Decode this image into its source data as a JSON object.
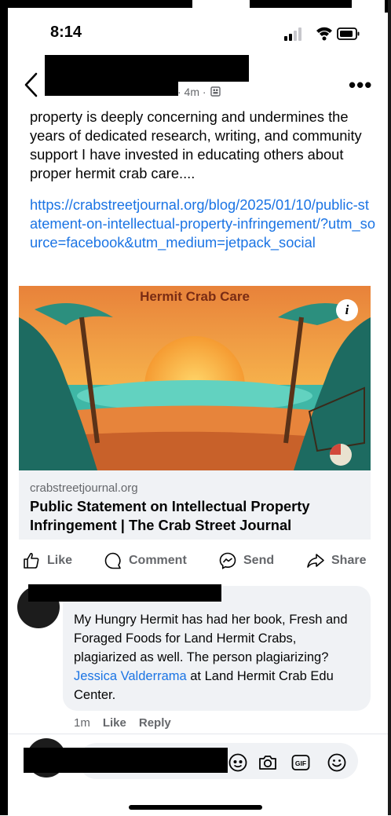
{
  "status_bar": {
    "time": "8:14"
  },
  "post": {
    "meta": "· 4m ·",
    "body": "property is deeply concerning and undermines the years of dedicated research, writing, and community support I have invested in educating others about proper hermit crab care....",
    "link": "https://crabstreetjournal.org/blog/2025/01/10/public-statement-on-intellectual-property-infringement/?utm_source=facebook&utm_medium=jetpack_social",
    "link_card": {
      "image_label": "Hermit Crab Care",
      "info_glyph": "i",
      "domain": "crabstreetjournal.org",
      "title": "Public Statement on Intellectual Property Infringement | The Crab Street Journal"
    }
  },
  "actions": {
    "like": "Like",
    "comment": "Comment",
    "send": "Send",
    "share": "Share"
  },
  "comment": {
    "text_before": "My Hungry Hermit has had her book, Fresh and Foraged Foods for Land Hermit Crabs, plagiarized as well. The person plagiarizing? ",
    "mention": "Jessica Valderrama",
    "text_after": " at Land Hermit Crab Edu Center.",
    "time": "1m",
    "like_label": "Like",
    "reply_label": "Reply"
  },
  "composer": {
    "icons": [
      "avatar-sticker-icon",
      "camera-icon",
      "gif-icon",
      "emoji-icon"
    ]
  },
  "colors": {
    "link": "#1b74e4",
    "muted": "#65676b",
    "bubble": "#f0f2f5"
  }
}
